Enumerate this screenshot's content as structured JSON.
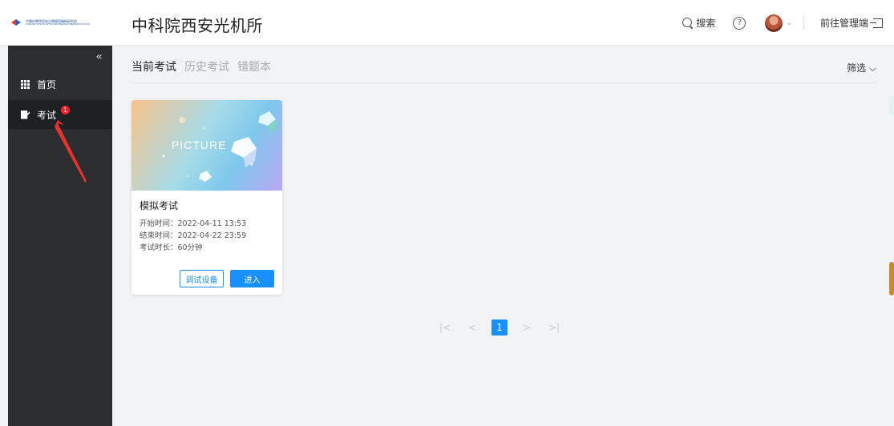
{
  "header": {
    "logo_text_cn": "中國科學院西安光學精密機械研究所",
    "logo_text_en": "XI'AN INSTITUTE OF OPTICS AND PRECISION MECHANICS OF CAS",
    "title": "中科院西安光机所",
    "search_label": "搜索",
    "help_symbol": "?",
    "avatar_caret": "⌄",
    "admin_link": "前往管理端"
  },
  "sidebar": {
    "collapse_symbol": "«",
    "items": [
      {
        "label": "首页",
        "icon": "grid-icon"
      },
      {
        "label": "考试",
        "icon": "edit-icon",
        "badge": "1"
      }
    ]
  },
  "tabs": [
    {
      "label": "当前考试",
      "active": true
    },
    {
      "label": "历史考试",
      "active": false
    },
    {
      "label": "错题本",
      "active": false
    }
  ],
  "filter_label": "筛选 ⌵",
  "exam_card": {
    "cover_text": "PICTURE",
    "title": "模拟考试",
    "start": "开始时间：2022-04-11 13:53",
    "end": "结束时间：2022-04-22 23:59",
    "duration": "考试时长：60分钟",
    "debug_button": "调试设备",
    "enter_button": "进入"
  },
  "pagination": {
    "first": "|<",
    "prev": "<",
    "current": "1",
    "next": ">",
    "last": ">|"
  },
  "colors": {
    "accent": "#1890ff",
    "sidebar_bg": "#2b2d31",
    "badge": "#f5222d",
    "annotation_arrow": "#e8332a"
  }
}
